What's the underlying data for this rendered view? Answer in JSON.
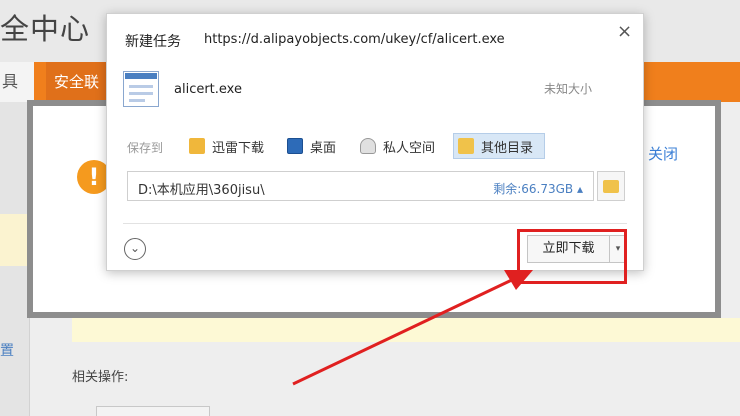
{
  "background": {
    "title": "全中心",
    "nav_first": "具",
    "nav_item": "安全联",
    "left_char": "置",
    "related_label": "相关操作:"
  },
  "security_dialog": {
    "close_label": "关闭"
  },
  "download_dialog": {
    "title": "新建任务",
    "url": "https://d.alipayobjects.com/ukey/cf/alicert.exe",
    "close_glyph": "×",
    "file_name": "alicert.exe",
    "file_size": "未知大小",
    "save_to_label": "保存到",
    "save_options": [
      {
        "label": "迅雷下载",
        "icon": "thunder-folder-icon"
      },
      {
        "label": "桌面",
        "icon": "desktop-icon"
      },
      {
        "label": "私人空间",
        "icon": "private-space-icon"
      },
      {
        "label": "其他目录",
        "icon": "folder-icon",
        "selected": true
      }
    ],
    "path": "D:\\本机应用\\360jisu\\",
    "free_space": "剩余:66.73GB ▴",
    "download_button": "立即下载",
    "dropdown_glyph": "▾",
    "expand_glyph": "⌄"
  },
  "colors": {
    "accent_orange": "#f07f1c",
    "highlight_red": "#e02020",
    "link_blue": "#3a7fd6"
  }
}
